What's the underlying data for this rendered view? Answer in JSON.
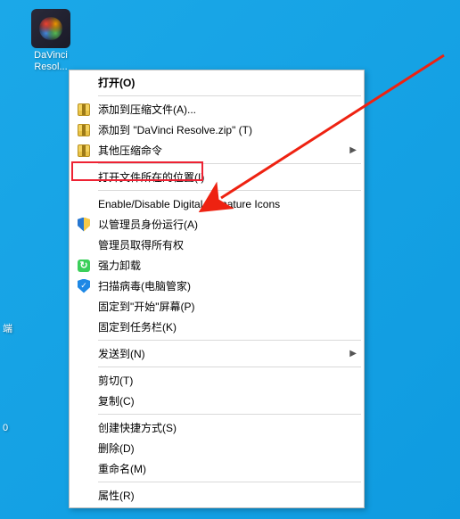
{
  "desktop": {
    "icon_label": "DaVinci Resol..."
  },
  "partials": {
    "p1": "端",
    "p2": "0"
  },
  "menu": {
    "open": "打开(O)",
    "add_archive": "添加到压缩文件(A)...",
    "add_zip": "添加到 \"DaVinci Resolve.zip\" (T)",
    "other_compress": "其他压缩命令",
    "open_location": "打开文件所在的位置(I)",
    "sig_icons": "Enable/Disable Digital Signature Icons",
    "run_admin": "以管理员身份运行(A)",
    "admin_ownership": "管理员取得所有权",
    "force_uninstall": "强力卸载",
    "scan_virus": "扫描病毒(电脑管家)",
    "pin_start": "固定到\"开始\"屏幕(P)",
    "pin_taskbar": "固定到任务栏(K)",
    "send_to": "发送到(N)",
    "cut": "剪切(T)",
    "copy": "复制(C)",
    "create_shortcut": "创建快捷方式(S)",
    "delete": "删除(D)",
    "rename": "重命名(M)",
    "properties": "属性(R)"
  }
}
